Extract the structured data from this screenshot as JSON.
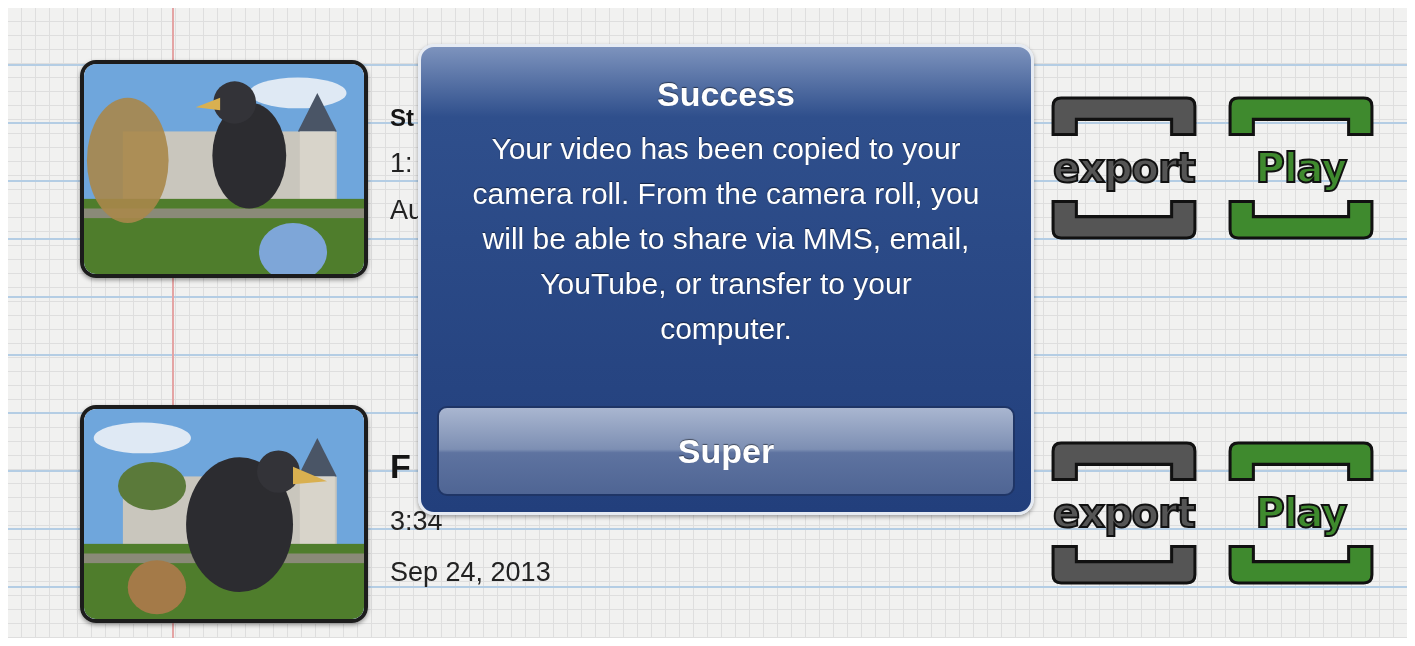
{
  "videos": [
    {
      "title": "St",
      "duration": "1:",
      "date": "Au",
      "actions": [
        {
          "label": "export",
          "color": "#555555"
        },
        {
          "label": "Play",
          "color": "#3f8a2e"
        }
      ]
    },
    {
      "title": "F",
      "duration": "3:34",
      "date": "Sep 24, 2013",
      "actions": [
        {
          "label": "export",
          "color": "#555555"
        },
        {
          "label": "Play",
          "color": "#3f8a2e"
        }
      ]
    }
  ],
  "alert": {
    "title": "Success",
    "message": "Your video has been copied to your camera roll. From the camera roll, you will be able to share via MMS, email, YouTube, or transfer to your computer.",
    "button": "Super"
  }
}
